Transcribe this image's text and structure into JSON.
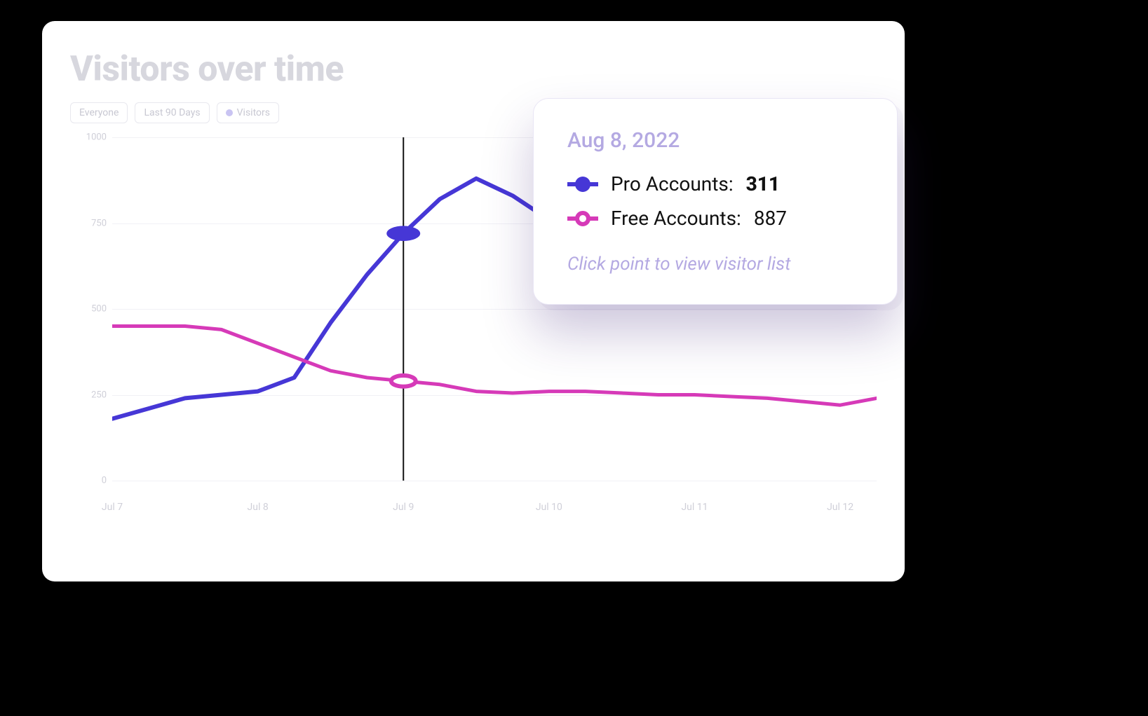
{
  "title": "Visitors over time",
  "filters": {
    "segment": "Everyone",
    "range": "Last 90 Days",
    "metric": "Visitors"
  },
  "tooltip": {
    "date": "Aug 8, 2022",
    "rows": [
      {
        "label": "Pro Accounts: ",
        "value": "311",
        "series": "pro",
        "active": true
      },
      {
        "label": "Free Accounts: ",
        "value": "887",
        "series": "free",
        "active": false
      }
    ],
    "hint": "Click point to view visitor list"
  },
  "axes": {
    "y_ticks": [
      "0",
      "250",
      "500",
      "750",
      "1000"
    ],
    "x_ticks": [
      "Jul 7",
      "Jul 8",
      "Jul 9",
      "Jul 10",
      "Jul 11",
      "Jul 12"
    ]
  },
  "colors": {
    "pro": "#4637d6",
    "free": "#d63ab8",
    "muted": "#cfcfd8",
    "lavender": "#b4a9e2"
  },
  "chart_data": {
    "type": "line",
    "title": "Visitors over time",
    "xlabel": "",
    "ylabel": "",
    "ylim": [
      0,
      1000
    ],
    "x": [
      0,
      1,
      2,
      3,
      4,
      5,
      6,
      7,
      8,
      9,
      10,
      11,
      12,
      13,
      14,
      15,
      16,
      17,
      18,
      19,
      20,
      21
    ],
    "x_tick_labels": {
      "0": "Jul 7",
      "4": "Jul 8",
      "8": "Jul 9",
      "12": "Jul 10",
      "16": "Jul 11",
      "20": "Jul 12"
    },
    "cursor_x": 8,
    "series": [
      {
        "name": "Pro Accounts",
        "color": "#4637d6",
        "values": [
          180,
          210,
          240,
          250,
          260,
          300,
          460,
          600,
          720,
          820,
          880,
          830,
          760
        ]
      },
      {
        "name": "Free Accounts",
        "color": "#d63ab8",
        "values": [
          450,
          450,
          450,
          440,
          400,
          360,
          320,
          300,
          290,
          280,
          260,
          255,
          260,
          260,
          255,
          250,
          250,
          245,
          240,
          230,
          220,
          240
        ]
      }
    ],
    "markers": [
      {
        "series": "Pro Accounts",
        "x": 8,
        "y": 720,
        "style": "filled"
      },
      {
        "series": "Free Accounts",
        "x": 8,
        "y": 290,
        "style": "hollow"
      }
    ]
  }
}
